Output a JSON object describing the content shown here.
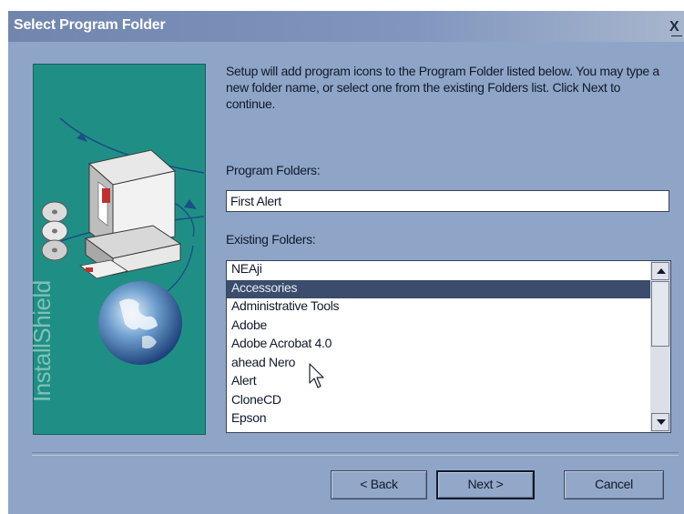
{
  "window": {
    "title": "Select Program Folder",
    "close_glyph": "X"
  },
  "side_panel": {
    "brand_text": "InstallShield",
    "icons": [
      "computer-icon",
      "cd-icon",
      "globe-icon"
    ]
  },
  "intro_text": "Setup will add program icons to the Program Folder listed below. You may type a new folder name, or select one from the existing Folders list.  Click Next to continue.",
  "program_folders": {
    "label": "Program Folders:",
    "value": "First Alert"
  },
  "existing_folders": {
    "label": "Existing Folders:",
    "items": [
      "NEAji",
      "Accessories",
      "Administrative Tools",
      "Adobe",
      "Adobe Acrobat 4.0",
      "ahead Nero",
      "Alert",
      "CloneCD",
      "Epson"
    ],
    "selected": "Accessories"
  },
  "buttons": {
    "back": "< Back",
    "next": "Next >",
    "cancel": "Cancel"
  },
  "colors": {
    "dialog_bg": "#8ea5c7",
    "title_bar": "#7185ad",
    "panel_teal": "#1f8f86",
    "selection": "#3b4c6c"
  }
}
